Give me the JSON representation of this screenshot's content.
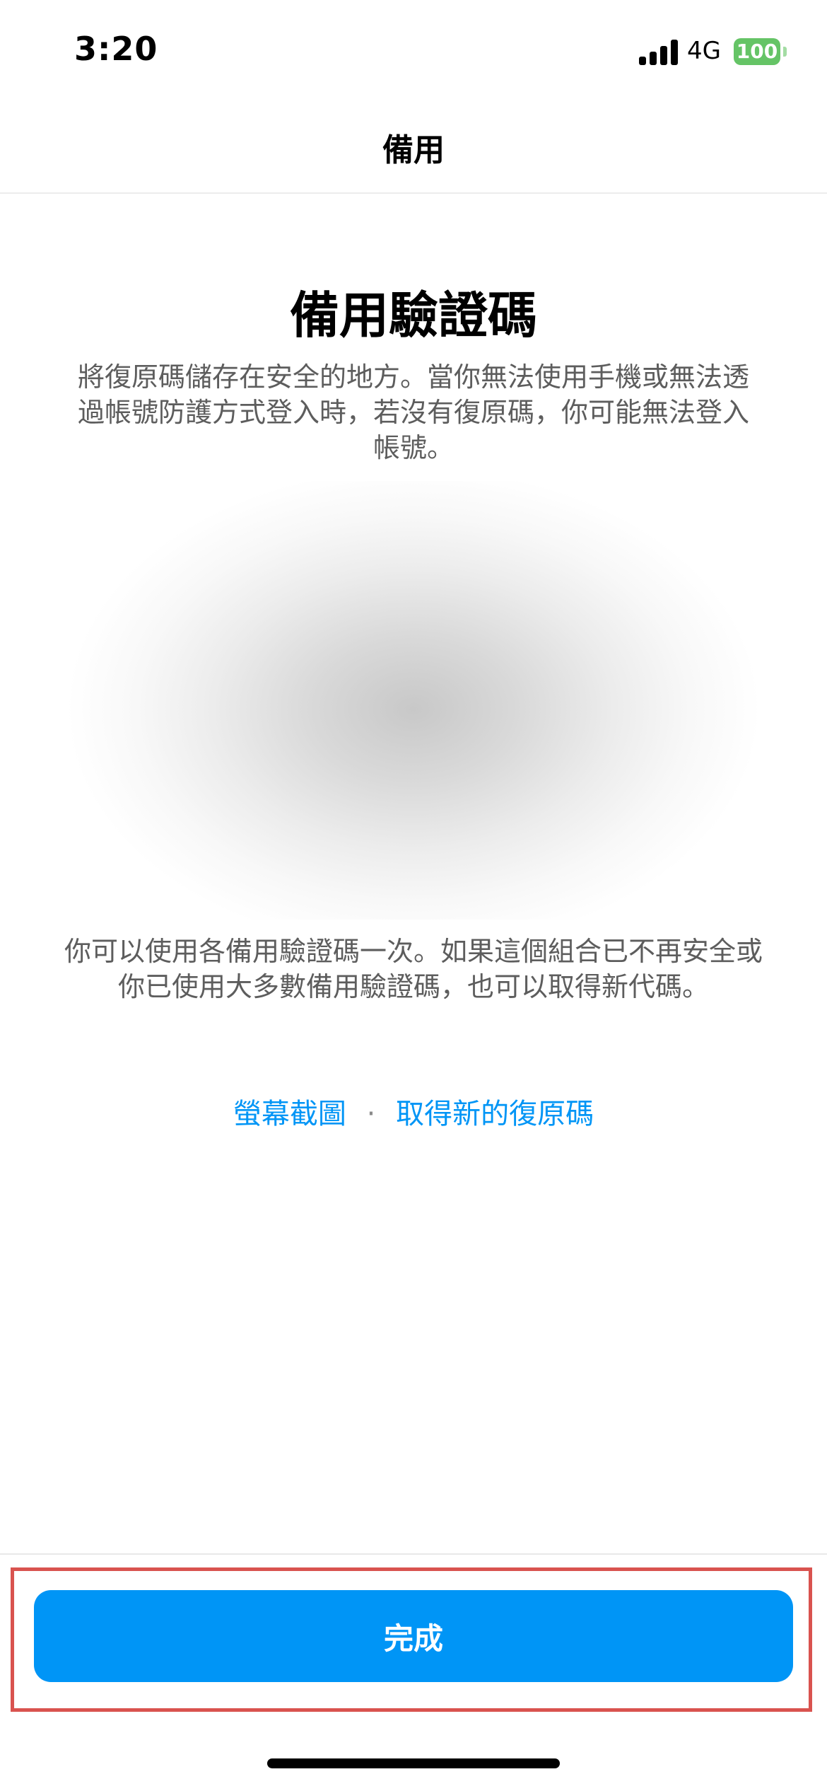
{
  "status_bar": {
    "time": "3:20",
    "network": "4G",
    "battery": "100"
  },
  "nav": {
    "title": "備用"
  },
  "main": {
    "heading": "備用驗證碼",
    "description": "將復原碼儲存在安全的地方。當你無法使用手機或無法透過帳號防護方式登入時，若沒有復原碼，你可能無法登入帳號。",
    "note": "你可以使用各備用驗證碼一次。如果這個組合已不再安全或你已使用大多數備用驗證碼，也可以取得新代碼。",
    "links": {
      "screenshot": "螢幕截圖",
      "separator": "·",
      "get_new_codes": "取得新的復原碼"
    }
  },
  "footer": {
    "done_label": "完成"
  },
  "colors": {
    "accent": "#0095f6",
    "battery": "#65c466",
    "highlight": "#d9534f"
  }
}
